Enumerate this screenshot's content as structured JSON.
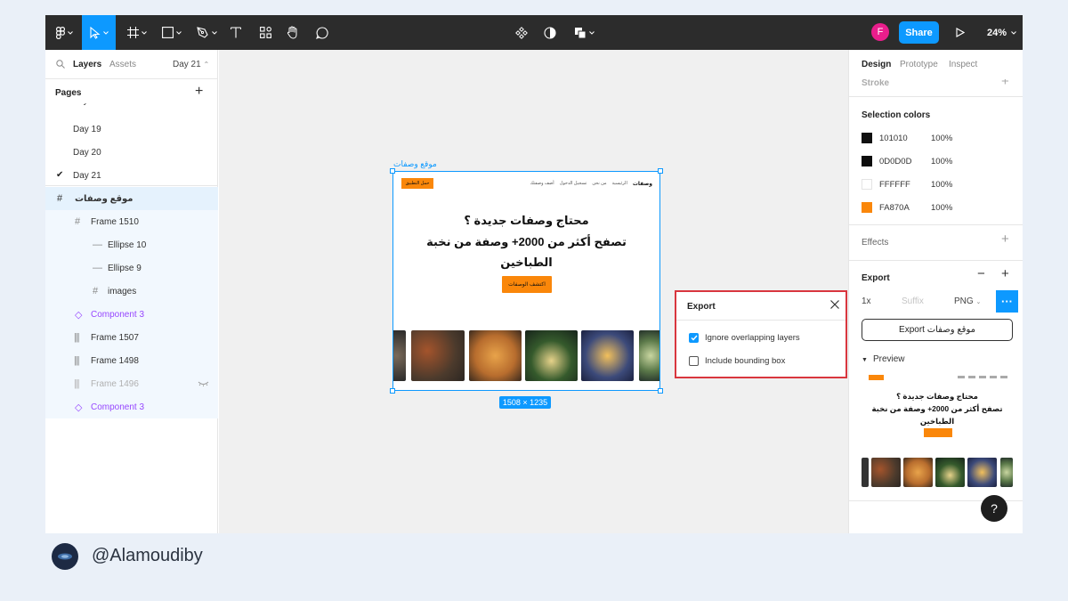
{
  "toolbar": {
    "avatar_initial": "F",
    "share_label": "Share",
    "zoom_label": "24%"
  },
  "left_panel": {
    "tab_layers": "Layers",
    "tab_assets": "Assets",
    "current_page": "Day 21",
    "pages_heading": "Pages",
    "pages": [
      "Day 19",
      "Day 20",
      "Day 21"
    ],
    "selected_frame": "موقع وصفات",
    "layers": [
      "Frame 1510",
      "Ellipse 10",
      "Ellipse 9",
      "images",
      "Component 3",
      "Frame 1507",
      "Frame 1498",
      "Frame 1496",
      "Component 3"
    ]
  },
  "canvas": {
    "frame_label": "موقع وصفات",
    "size_badge": "1508 × 1235",
    "frame": {
      "cta_top": "حمل التطبيق",
      "nav_brand": "وصفات",
      "nav_items": [
        "الرئيسية",
        "من نحن",
        "تسجيل الدخول",
        "أضف وصفتك"
      ],
      "headline_1": "محتاج وصفات جديدة ؟",
      "headline_2": "تصفح أكثر من 2000+ وصفة من نخبة",
      "headline_3": "الطباخين",
      "cta_main": "اكتشف الوصفات"
    }
  },
  "export_popover": {
    "title": "Export",
    "option_1": "Ignore overlapping layers",
    "option_1_checked": true,
    "option_2": "Include bounding box",
    "option_2_checked": false
  },
  "right_panel": {
    "tab_design": "Design",
    "tab_prototype": "Prototype",
    "tab_inspect": "Inspect",
    "stroke_heading": "Stroke",
    "selection_colors_heading": "Selection colors",
    "colors": [
      {
        "hex": "101010",
        "opacity": "100%",
        "swatch": "#101010"
      },
      {
        "hex": "0D0D0D",
        "opacity": "100%",
        "swatch": "#0d0d0d"
      },
      {
        "hex": "FFFFFF",
        "opacity": "100%",
        "swatch": "#ffffff"
      },
      {
        "hex": "FA870A",
        "opacity": "100%",
        "swatch": "#fa870a"
      }
    ],
    "effects_heading": "Effects",
    "export_heading": "Export",
    "export_scale": "1x",
    "export_suffix_placeholder": "Suffix",
    "export_format": "PNG",
    "export_button": "Export موقع وصفات",
    "preview_label": "Preview",
    "preview_headline_1": "محتاج وصفات جديدة ؟",
    "preview_headline_2": "تصفح أكثر من 2000+ وصفة من نخبة",
    "preview_headline_3": "الطباخين",
    "help_label": "?"
  },
  "footer": {
    "handle": "@Alamoudiby"
  },
  "colors": {
    "accent": "#0d99ff",
    "brand_orange": "#fa870a",
    "highlight_red": "#d9363e",
    "toolbar_bg": "#2c2c2c"
  }
}
